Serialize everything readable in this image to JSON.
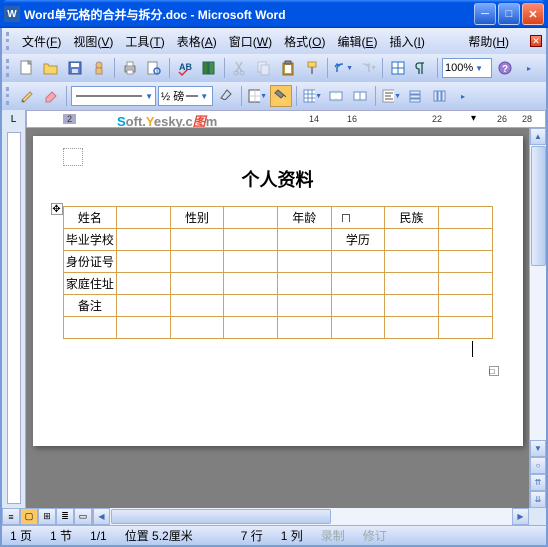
{
  "window": {
    "title": "Word单元格的合并与拆分.doc - Microsoft Word",
    "app_icon": "W"
  },
  "menu": {
    "items": [
      {
        "label": "文件",
        "accel": "F"
      },
      {
        "label": "视图",
        "accel": "V"
      },
      {
        "label": "工具",
        "accel": "T"
      },
      {
        "label": "表格",
        "accel": "A"
      },
      {
        "label": "窗口",
        "accel": "W"
      },
      {
        "label": "格式",
        "accel": "O"
      },
      {
        "label": "编辑",
        "accel": "E"
      },
      {
        "label": "插入",
        "accel": "I"
      },
      {
        "label": "帮助",
        "accel": "H"
      }
    ]
  },
  "toolbar1": {
    "zoom": "100%"
  },
  "toolbar2": {
    "line_weight": "½ 磅",
    "border_color": "#000000",
    "shade_color": "#ffcc66"
  },
  "ruler": {
    "corner": "L",
    "h_numbers": [
      "2",
      "14",
      "16",
      "22",
      "26",
      "28"
    ],
    "watermark_parts": [
      "S",
      "oft.",
      "Y",
      "esky.",
      "c",
      "图",
      "m"
    ]
  },
  "document": {
    "title": "个人资料",
    "table_labels": {
      "r1c1": "姓名",
      "r1c3": "性别",
      "r1c5": "年龄",
      "r1c7": "民族",
      "r2c1": "毕业学校",
      "r2c6": "学历",
      "r3c1": "身份证号",
      "r4c1": "家庭住址",
      "r5c1": "备注"
    }
  },
  "status": {
    "page": "1 页",
    "section": "1 节",
    "pages": "1/1",
    "position": "位置 5.2厘米",
    "line": "7 行",
    "column": "1 列",
    "rec": "录制",
    "rev": "修订"
  }
}
